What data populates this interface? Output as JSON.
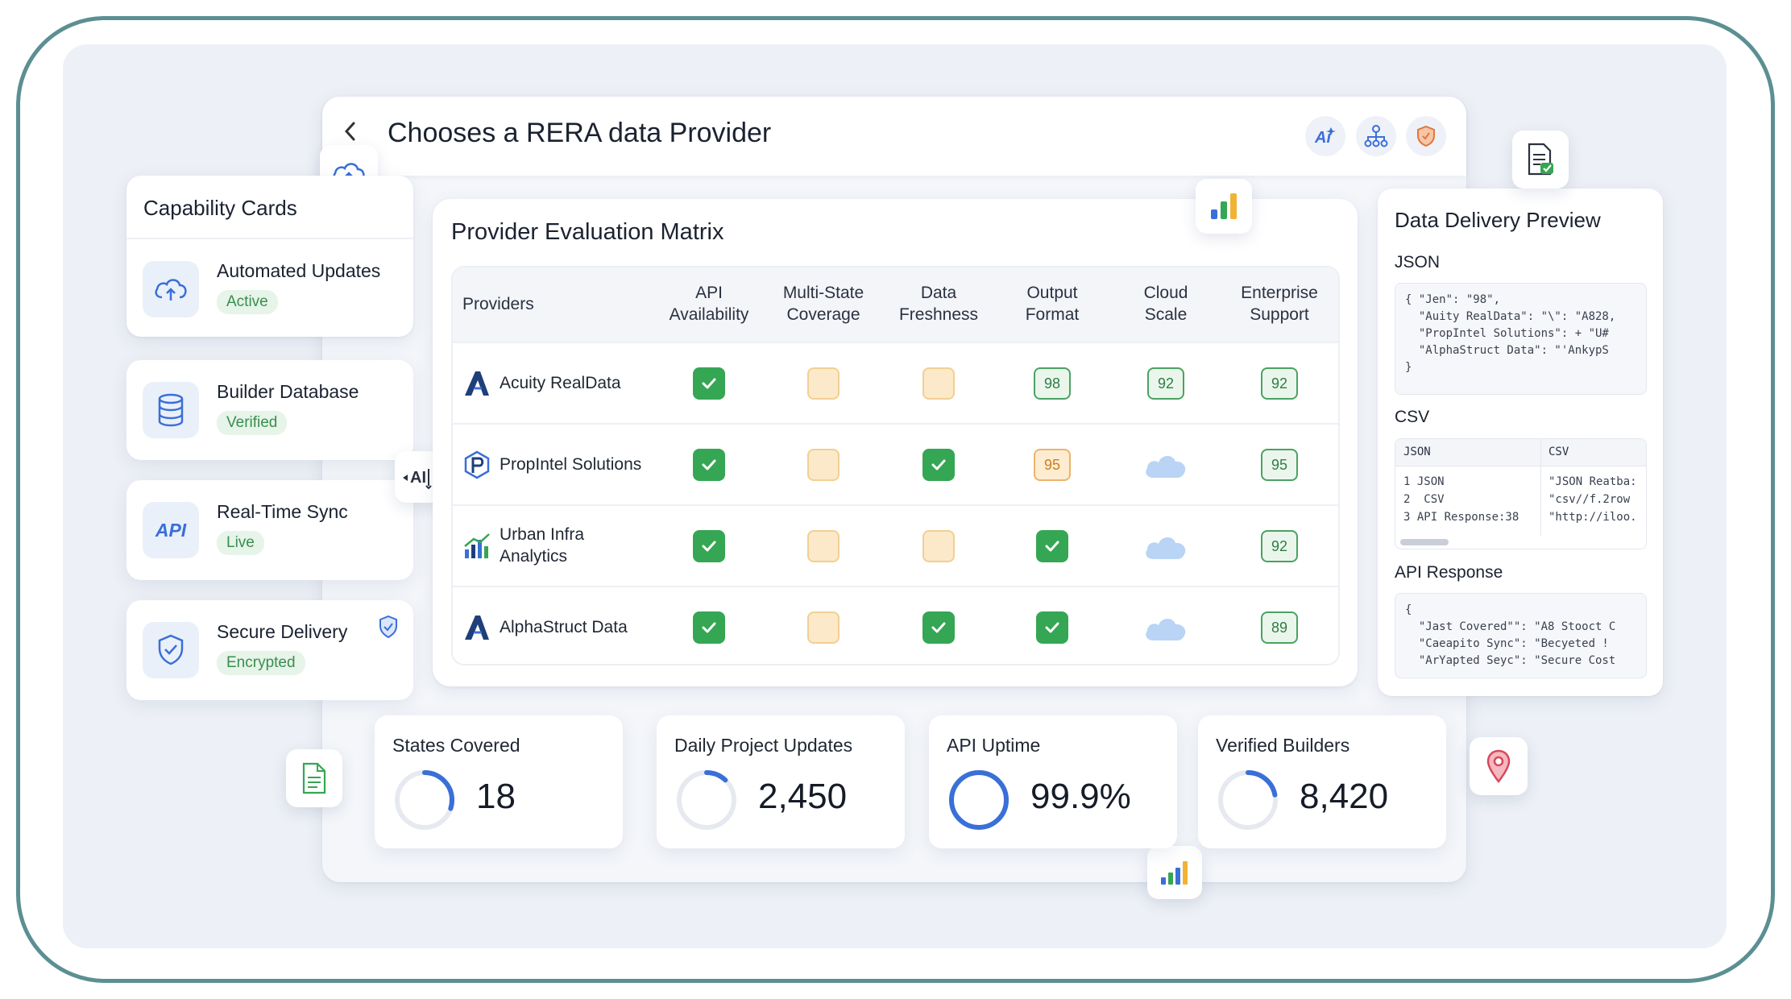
{
  "header": {
    "back_icon": "chevron-left-icon",
    "title": "Chooses a RERA data Provider",
    "icons": [
      "ai-icon",
      "network-icon",
      "shield-icon"
    ]
  },
  "capability": {
    "title": "Capability Cards",
    "cards": [
      {
        "name": "Automated Updates",
        "badge": "Active",
        "icon": "cloud-upload-icon"
      },
      {
        "name": "Builder Database",
        "badge": "Verified",
        "icon": "database-icon"
      },
      {
        "name": "Real-Time Sync",
        "badge": "Live",
        "icon": "api-icon",
        "icon_text": "API"
      },
      {
        "name": "Secure Delivery",
        "badge": "Encrypted",
        "icon": "shield-check-icon"
      }
    ],
    "floating_api_text": "AI"
  },
  "matrix": {
    "title": "Provider Evaluation Matrix",
    "columns": [
      {
        "line1": "Providers",
        "line2": ""
      },
      {
        "line1": "API",
        "line2": "Availability"
      },
      {
        "line1": "Multi-State",
        "line2": "Coverage"
      },
      {
        "line1": "Data",
        "line2": "Freshness"
      },
      {
        "line1": "Output",
        "line2": "Format"
      },
      {
        "line1": "Cloud",
        "line2": "Scale"
      },
      {
        "line1": "Enterprise",
        "line2": "Support"
      }
    ],
    "rows": [
      {
        "provider_line1": "Acuity RealData",
        "provider_line2": "",
        "logo": "a-logo-icon",
        "cells": [
          {
            "t": "check"
          },
          {
            "t": "pending"
          },
          {
            "t": "pending"
          },
          {
            "t": "score",
            "v": "98"
          },
          {
            "t": "score",
            "v": "92"
          },
          {
            "t": "score",
            "v": "92"
          }
        ]
      },
      {
        "provider_line1": "PropIntel Solutions",
        "provider_line2": "",
        "logo": "p-logo-icon",
        "cells": [
          {
            "t": "check"
          },
          {
            "t": "pending"
          },
          {
            "t": "check"
          },
          {
            "t": "score-warn",
            "v": "95"
          },
          {
            "t": "cloud"
          },
          {
            "t": "score",
            "v": "95"
          }
        ]
      },
      {
        "provider_line1": "Urban Infra",
        "provider_line2": "Analytics",
        "logo": "bar-logo-icon",
        "cells": [
          {
            "t": "check"
          },
          {
            "t": "pending"
          },
          {
            "t": "pending"
          },
          {
            "t": "check"
          },
          {
            "t": "cloud"
          },
          {
            "t": "score",
            "v": "92"
          }
        ]
      },
      {
        "provider_line1": "AlphaStruct Data",
        "provider_line2": "",
        "logo": "a-logo-icon",
        "cells": [
          {
            "t": "check"
          },
          {
            "t": "pending"
          },
          {
            "t": "check"
          },
          {
            "t": "check"
          },
          {
            "t": "cloud"
          },
          {
            "t": "score",
            "v": "89"
          }
        ]
      }
    ]
  },
  "delivery": {
    "title": "Data Delivery Preview",
    "json_label": "JSON",
    "json_lines": [
      "{ \"Jen\": \"98\",",
      "  \"Auity RealData\": \"\\\": \"A828,",
      "  \"PropIntel Solutions\": + \"U#",
      "  \"AlphaStruct Data\": \"'AnkypS",
      "}"
    ],
    "csv_label": "CSV",
    "csv_headers": [
      "JSON",
      "CSV"
    ],
    "csv_left": [
      "1 JSON",
      "2  CSV",
      "3 API Response:38"
    ],
    "csv_right": [
      "\"JSON Reatba:",
      "\"csv//f.2row",
      "\"http://iloo."
    ],
    "api_label": "API Response",
    "api_lines": [
      "{",
      "  \"Jast Covered\"\": \"A8 Stooct C",
      "  \"Caeapito Sync\": \"Becyeted !",
      "  \"ArYapted Seyc\": \"Secure Cost"
    ]
  },
  "stats": [
    {
      "label": "States Covered",
      "value": "18",
      "progress": 0.3
    },
    {
      "label": "Daily Project Updates",
      "value": "2,450",
      "progress": 0.12
    },
    {
      "label": "API Uptime",
      "value": "99.9%",
      "progress": 0.999
    },
    {
      "label": "Verified Builders",
      "value": "8,420",
      "progress": 0.22
    }
  ],
  "colors": {
    "accent": "#3a6fd8",
    "success": "#35a653",
    "pending": "#fbe9c9",
    "frame": "#5b8f93"
  }
}
